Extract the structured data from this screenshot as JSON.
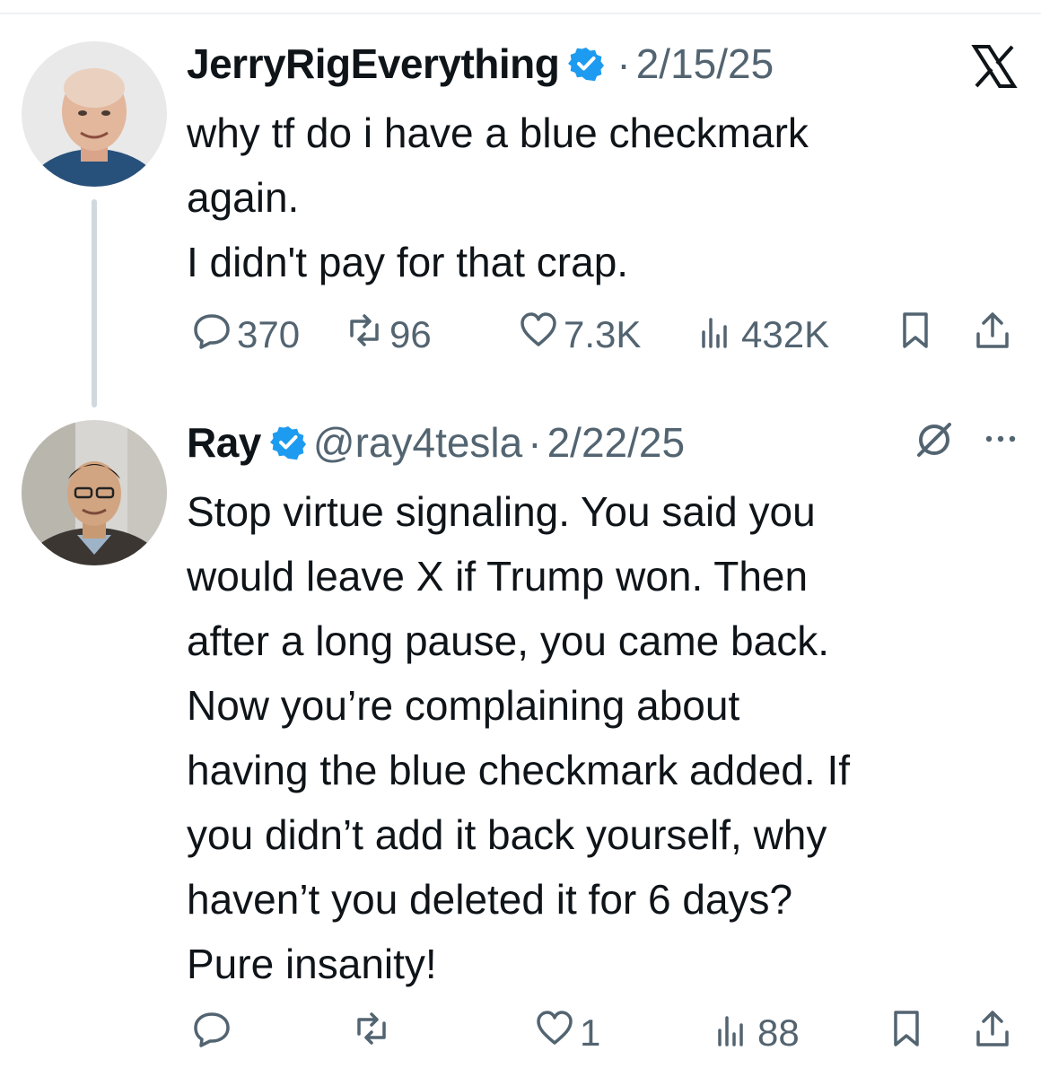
{
  "colors": {
    "verified": "#1d9bf0",
    "secondary_text": "#536471",
    "primary_text": "#0f1419",
    "thread_line": "#cfd9de"
  },
  "tweets": [
    {
      "display_name": "JerryRigEverything",
      "verified": true,
      "handle": "",
      "separator": "·",
      "date": "2/15/25",
      "avatar_icon": "avatar-photo",
      "text_lines": [
        "why tf do i have a blue checkmark",
        "again.",
        "I didn't pay for that crap."
      ],
      "actions": {
        "replies": "370",
        "reposts": "96",
        "likes": "7.3K",
        "views": "432K"
      }
    },
    {
      "display_name": "Ray",
      "verified": true,
      "handle": "@ray4tesla",
      "separator": "·",
      "date": "2/22/25",
      "avatar_icon": "avatar-photo",
      "text_lines": [
        "Stop virtue signaling. You said you",
        "would leave X if Trump won. Then",
        "after a long pause, you came back.",
        "Now you’re complaining about",
        "having the blue checkmark added. If",
        "you didn’t add it back yourself, why",
        "haven’t you deleted it for 6 days?",
        "Pure insanity!"
      ],
      "actions": {
        "replies": "",
        "reposts": "",
        "likes": "1",
        "views": "88"
      }
    }
  ],
  "icons": [
    "x-logo-icon",
    "grok-icon",
    "more-icon",
    "reply-icon",
    "repost-icon",
    "like-icon",
    "views-icon",
    "bookmark-icon",
    "share-icon",
    "verified-badge-icon"
  ]
}
